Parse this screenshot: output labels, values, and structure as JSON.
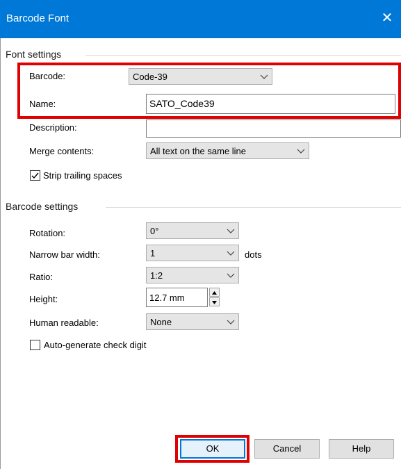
{
  "window": {
    "title": "Barcode Font",
    "close_glyph": "✕"
  },
  "font_settings": {
    "header": "Font settings",
    "barcode_label": "Barcode:",
    "barcode_value": "Code-39",
    "name_label": "Name:",
    "name_value": "SATO_Code39",
    "description_label": "Description:",
    "description_value": "",
    "merge_label": "Merge contents:",
    "merge_value": "All text on the same line",
    "strip_label": "Strip trailing spaces",
    "strip_checked": true
  },
  "barcode_settings": {
    "header": "Barcode settings",
    "rotation_label": "Rotation:",
    "rotation_value": "0°",
    "narrow_label": "Narrow bar width:",
    "narrow_value": "1",
    "narrow_unit": "dots",
    "ratio_label": "Ratio:",
    "ratio_value": "1:2",
    "height_label": "Height:",
    "height_value": "12.7 mm",
    "human_label": "Human readable:",
    "human_value": "None",
    "autocheck_label": "Auto-generate check digit",
    "autocheck_checked": false
  },
  "buttons": {
    "ok": "OK",
    "cancel": "Cancel",
    "help": "Help"
  },
  "colors": {
    "titlebar": "#0078d7",
    "highlight": "#e00000"
  }
}
